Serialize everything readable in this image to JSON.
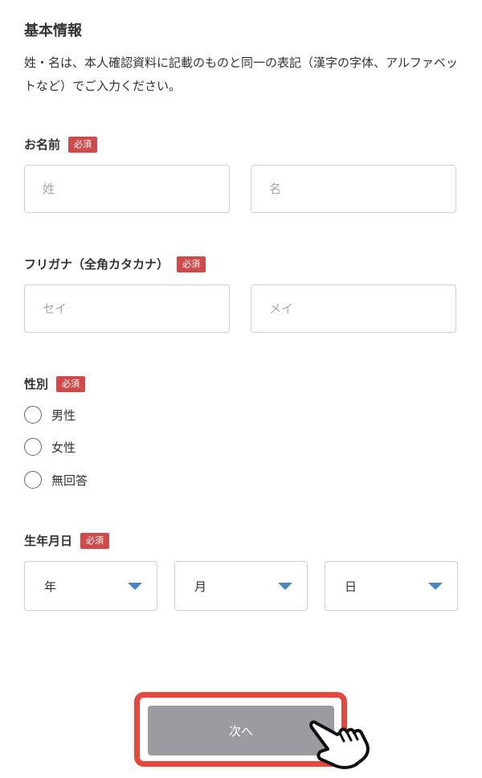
{
  "section": {
    "title": "基本情報",
    "description": "姓・名は、本人確認資料に記載のものと同一の表記（漢字の字体、アルファベットなど）でご入力ください。"
  },
  "required_badge": "必須",
  "name": {
    "label": "お名前",
    "last_placeholder": "姓",
    "first_placeholder": "名"
  },
  "kana": {
    "label": "フリガナ（全角カタカナ）",
    "last_placeholder": "セイ",
    "first_placeholder": "メイ"
  },
  "gender": {
    "label": "性別",
    "options": [
      "男性",
      "女性",
      "無回答"
    ]
  },
  "birthdate": {
    "label": "生年月日",
    "year": "年",
    "month": "月",
    "day": "日"
  },
  "next_button": "次へ",
  "colors": {
    "badge": "#cf4b4b",
    "caret": "#4a86c5",
    "button": "#9a9ca1",
    "highlight": "#e5483d"
  }
}
